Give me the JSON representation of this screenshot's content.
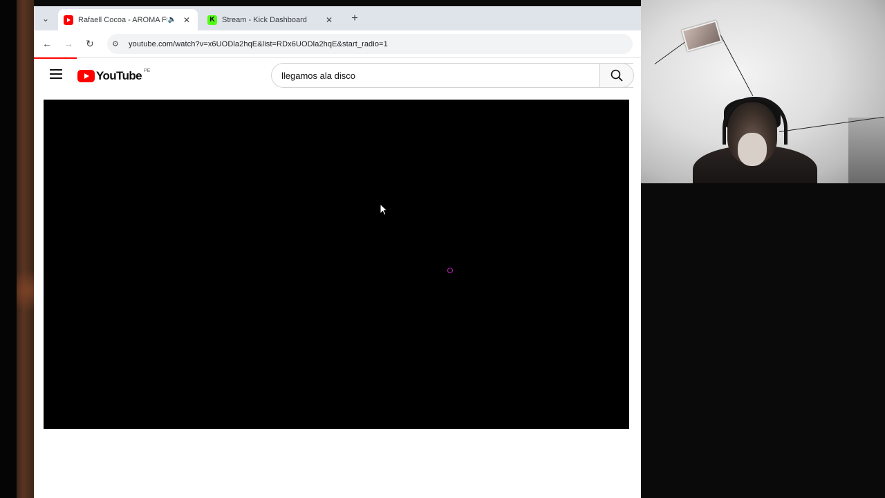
{
  "browser": {
    "tabs": [
      {
        "title": "Rafaell Cocoa - AROMA Ft.",
        "favicon": "youtube-favicon",
        "active": true,
        "playing_audio": true
      },
      {
        "title": "Stream - Kick Dashboard",
        "favicon": "kick-favicon",
        "active": false
      }
    ],
    "url": "youtube.com/watch?v=x6UODla2hqE&list=RDx6UODla2hqE&start_radio=1"
  },
  "youtube": {
    "logo_text": "YouTube",
    "country_code": "PE",
    "search": {
      "query": "llegamos ala disco"
    },
    "player": {
      "state": "loading"
    }
  },
  "colors": {
    "youtube_red": "#ff0000",
    "kick_green": "#53fc18",
    "spinner": "#c020c0"
  }
}
